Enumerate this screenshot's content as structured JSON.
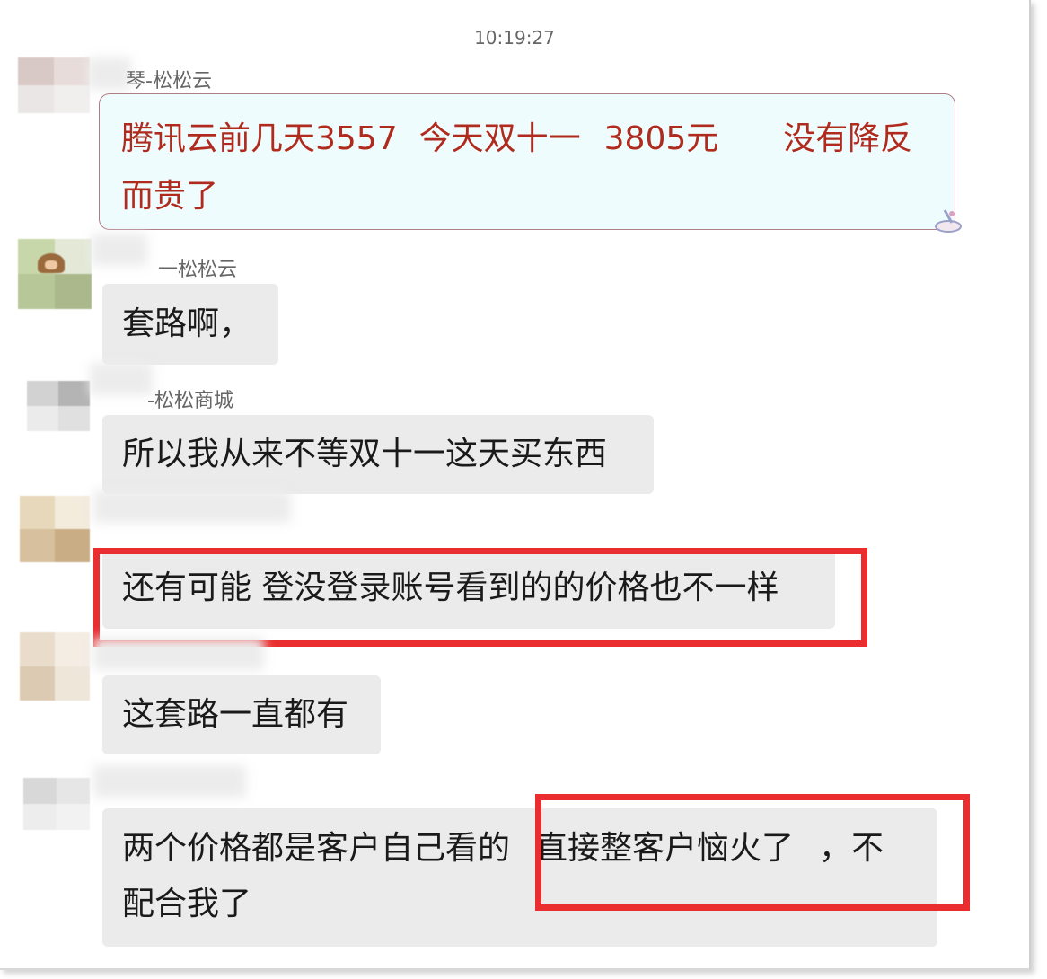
{
  "chat": {
    "timestamp": "10:19:27",
    "messages": [
      {
        "sender": "琴-松松云",
        "lines": [
          "腾讯云前几天3557",
          "今天双十一",
          "3805元",
          "没有降反",
          "而贵了"
        ],
        "style": "highlighted"
      },
      {
        "sender": "一松松云",
        "lines": [
          "套路啊，"
        ]
      },
      {
        "sender": "-松松商城",
        "lines": [
          "所以我从来不等双十一这天买东西"
        ]
      },
      {
        "sender": "",
        "lines": [
          "还有可能 登没登录账号看到的的价格也不一样"
        ],
        "highlight_box": true
      },
      {
        "sender": "",
        "lines": [
          "这套路一直都有"
        ]
      },
      {
        "sender": "",
        "lines": [
          "两个价格都是客户自己看的",
          "直接整客户恼火了",
          "，不",
          "配合我了"
        ],
        "partial_highlight": "直接整客户恼火了"
      }
    ]
  },
  "colors": {
    "bubble": "#ebebeb",
    "special_bubble_bg": "#eefcfd",
    "special_text": "#b02a1d",
    "highlight_border": "#ea2e30",
    "sender_text": "#666666"
  },
  "icons": {
    "shake_icon": "shake-icon"
  }
}
